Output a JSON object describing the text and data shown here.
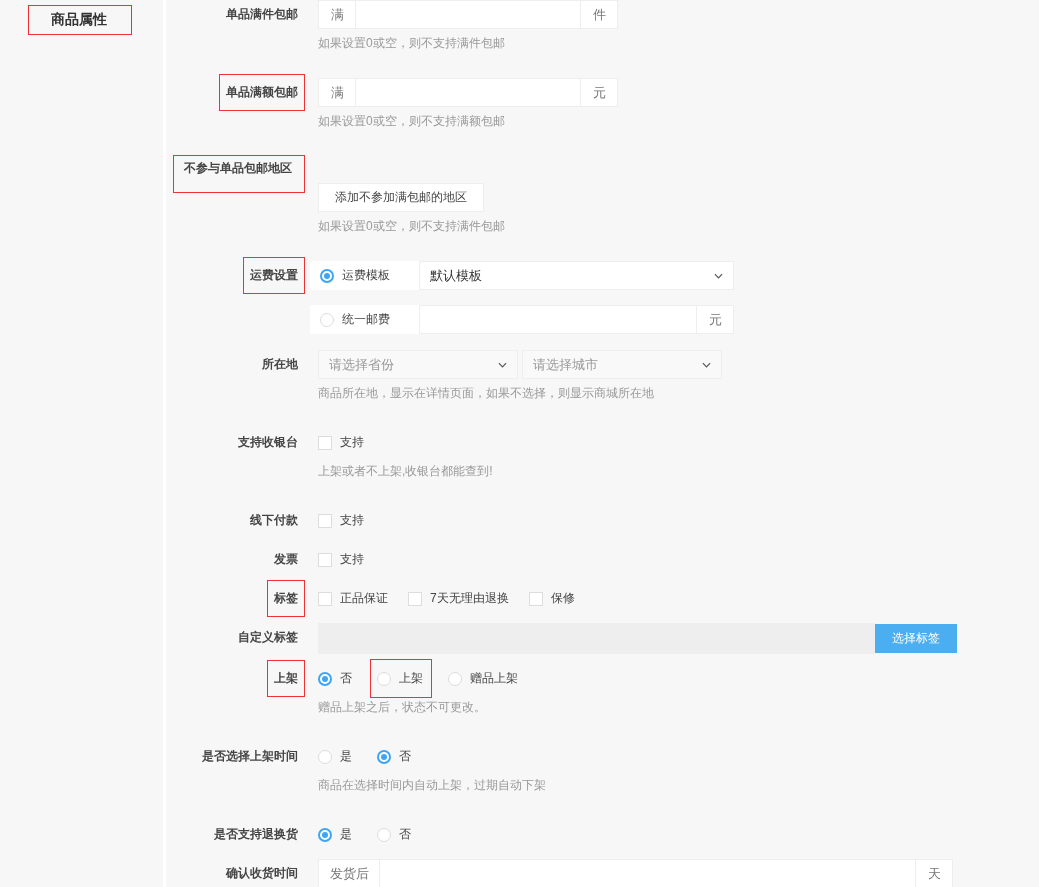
{
  "sidebar": {
    "title": "商品属性",
    "marked": true
  },
  "fields": [
    {
      "kind": "addon",
      "label": "单品满件包邮",
      "marked": false,
      "prefix": "满",
      "suffix": "件",
      "hint": "如果设置0或空，则不支持满件包邮"
    },
    {
      "kind": "addon",
      "label": "单品满额包邮",
      "marked": true,
      "prefix": "满",
      "suffix": "元",
      "hint": "如果设置0或空，则不支持满额包邮"
    },
    {
      "kind": "button",
      "label": "不参与单品包邮地区",
      "marked": true,
      "button": "添加不参加满包邮的地区",
      "hint": "如果设置0或空，则不支持满件包邮"
    },
    {
      "kind": "shipping",
      "label": "运费设置",
      "marked": true,
      "options": [
        {
          "label": "运费模板",
          "selected": true,
          "select": "默认模板"
        },
        {
          "label": "统一邮费",
          "selected": false,
          "suffix": "元"
        }
      ]
    },
    {
      "kind": "selects",
      "label": "所在地",
      "marked": false,
      "selects": [
        {
          "placeholder": "请选择省份"
        },
        {
          "placeholder": "请选择城市"
        }
      ],
      "hint": "商品所在地，显示在详情页面，如果不选择，则显示商城所在地"
    },
    {
      "kind": "checks",
      "label": "支持收银台",
      "marked": false,
      "options": [
        {
          "label": "支持",
          "checked": false
        }
      ],
      "hint": "上架或者不上架,收银台都能查到!"
    },
    {
      "kind": "checks",
      "label": "线下付款",
      "marked": false,
      "options": [
        {
          "label": "支持",
          "checked": false
        }
      ]
    },
    {
      "kind": "checks",
      "label": "发票",
      "marked": false,
      "options": [
        {
          "label": "支持",
          "checked": false
        }
      ]
    },
    {
      "kind": "checks",
      "label": "标签",
      "marked": true,
      "options": [
        {
          "label": "正品保证",
          "checked": false
        },
        {
          "label": "7天无理由退换",
          "checked": false
        },
        {
          "label": "保修",
          "checked": false
        }
      ]
    },
    {
      "kind": "tags",
      "label": "自定义标签",
      "marked": false,
      "button": "选择标签"
    },
    {
      "kind": "radios",
      "label": "上架",
      "marked": true,
      "options": [
        {
          "label": "否",
          "selected": true,
          "marked": false
        },
        {
          "label": "上架",
          "selected": false,
          "marked": true
        },
        {
          "label": "赠品上架",
          "selected": false,
          "marked": false
        }
      ],
      "hint": "赠品上架之后，状态不可更改。"
    },
    {
      "kind": "radios",
      "label": "是否选择上架时间",
      "marked": false,
      "options": [
        {
          "label": "是",
          "selected": false,
          "marked": false
        },
        {
          "label": "否",
          "selected": true,
          "marked": false
        }
      ],
      "hint": "商品在选择时间内自动上架，过期自动下架"
    },
    {
      "kind": "radios",
      "label": "是否支持退换货",
      "marked": false,
      "options": [
        {
          "label": "是",
          "selected": true,
          "marked": false
        },
        {
          "label": "否",
          "selected": false,
          "marked": false
        }
      ]
    },
    {
      "kind": "long_addon",
      "label": "确认收货时间",
      "marked": false,
      "prefix": "发货后",
      "suffix": "天"
    }
  ]
}
